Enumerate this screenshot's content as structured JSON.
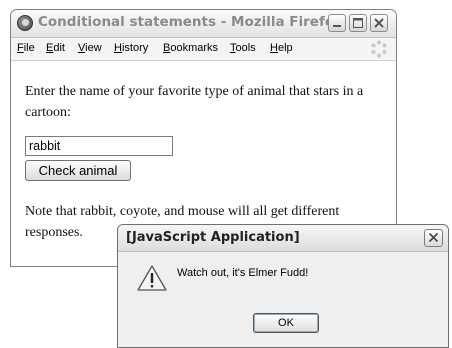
{
  "browser": {
    "title": "Conditional statements - Mozilla Firefox",
    "menu": [
      "File",
      "Edit",
      "View",
      "History",
      "Bookmarks",
      "Tools",
      "Help"
    ]
  },
  "page": {
    "prompt": "Enter the name of your favorite type of animal that stars in a cartoon:",
    "input_value": "rabbit",
    "button_label": "Check animal",
    "note": "Note that rabbit, coyote, and mouse will all get different responses."
  },
  "dialog": {
    "title": "[JavaScript Application]",
    "message": "Watch out, it's Elmer Fudd!",
    "ok_label": "OK"
  },
  "icons": {
    "app": "firefox-icon",
    "window_controls": [
      "minimize-icon",
      "maximize-icon",
      "close-icon"
    ],
    "throbber": "throbber-icon",
    "dialog_close": "close-icon",
    "dialog_warning": "warning-icon"
  }
}
